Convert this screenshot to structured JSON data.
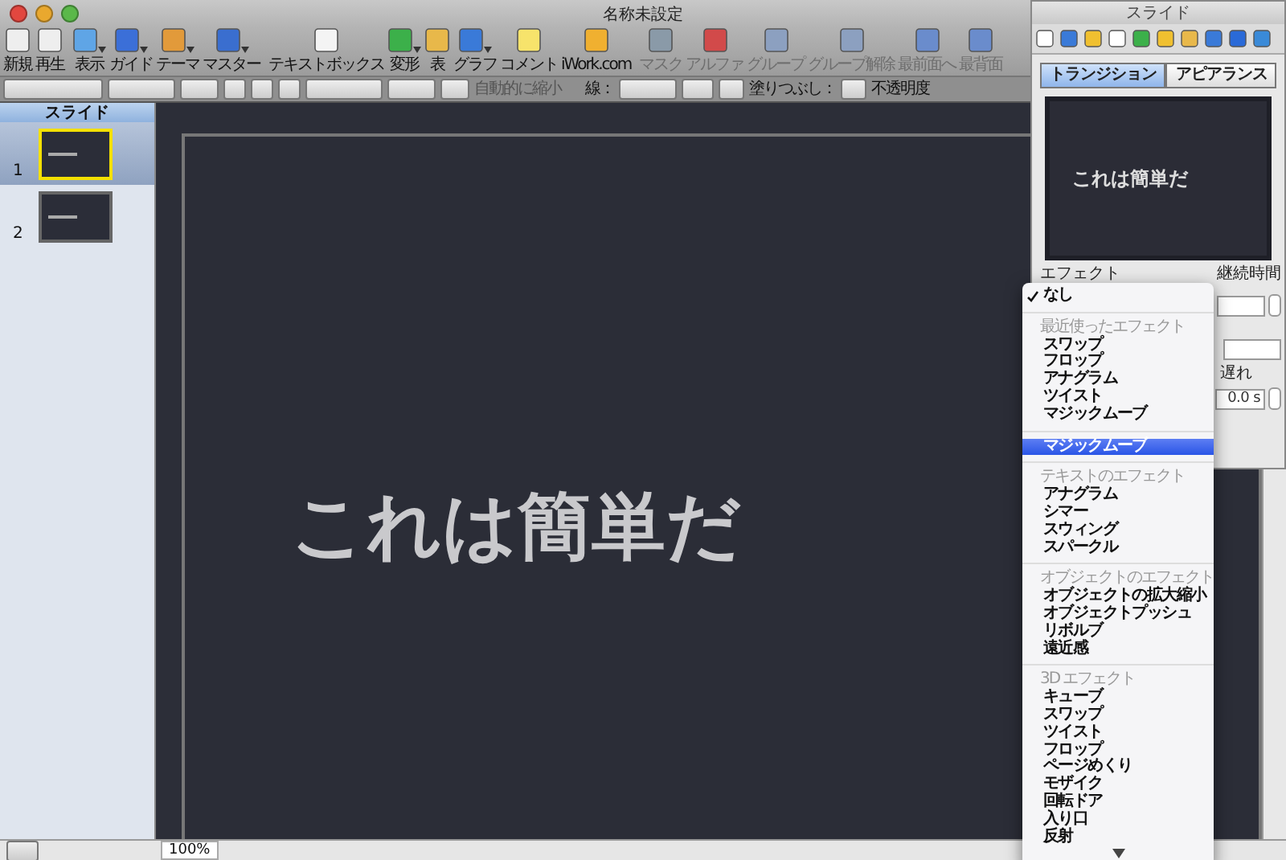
{
  "window": {
    "title": "名称未設定"
  },
  "toolbar": [
    {
      "label": "新規",
      "caret": false,
      "disabled": false
    },
    {
      "label": "再生",
      "caret": false,
      "disabled": false
    },
    {
      "label": "表示",
      "caret": true,
      "disabled": false
    },
    {
      "label": "ガイド",
      "caret": true,
      "disabled": false
    },
    {
      "label": "テーマ",
      "caret": true,
      "disabled": false
    },
    {
      "label": "マスター",
      "caret": true,
      "disabled": false
    },
    {
      "label": "テキストボックス",
      "caret": false,
      "disabled": false
    },
    {
      "label": "変形",
      "caret": true,
      "disabled": false
    },
    {
      "label": "表",
      "caret": false,
      "disabled": false
    },
    {
      "label": "グラフ",
      "caret": true,
      "disabled": false
    },
    {
      "label": "コメント",
      "caret": false,
      "disabled": false
    },
    {
      "label": "iWork.com",
      "caret": false,
      "disabled": false
    },
    {
      "label": "マスク",
      "caret": false,
      "disabled": true
    },
    {
      "label": "アルファ",
      "caret": false,
      "disabled": true
    },
    {
      "label": "グループ",
      "caret": false,
      "disabled": true
    },
    {
      "label": "グループ解除",
      "caret": false,
      "disabled": true
    },
    {
      "label": "最前面へ",
      "caret": false,
      "disabled": true
    },
    {
      "label": "最背面",
      "caret": false,
      "disabled": true
    }
  ],
  "format_bar": {
    "shrink_label": "自動的に縮小",
    "line_label": "線：",
    "fill_label": "塗りつぶし：",
    "opacity_label": "不透明度"
  },
  "sidebar": {
    "title": "スライド",
    "slides": [
      {
        "number": "1",
        "selected": true
      },
      {
        "number": "2",
        "selected": false
      }
    ]
  },
  "slide": {
    "text": "これは簡単だ"
  },
  "status_bar": {
    "zoom": "100%"
  },
  "inspector": {
    "title": "スライド",
    "tabs": [
      {
        "label": "トランジション",
        "selected": true
      },
      {
        "label": "アピアランス",
        "selected": false
      }
    ],
    "preview_text": "これは簡単だ",
    "effect_label": "エフェクト",
    "duration_label": "継続時間",
    "delay_label": "遅れ",
    "delay_value": "0.0 s"
  },
  "effect_menu": [
    {
      "kind": "item",
      "label": "なし",
      "checked": true,
      "selected": false
    },
    {
      "kind": "separator"
    },
    {
      "kind": "header",
      "label": "最近使ったエフェクト"
    },
    {
      "kind": "item",
      "label": "スワップ",
      "checked": false,
      "selected": false
    },
    {
      "kind": "item",
      "label": "フロップ",
      "checked": false,
      "selected": false
    },
    {
      "kind": "item",
      "label": "アナグラム",
      "checked": false,
      "selected": false
    },
    {
      "kind": "item",
      "label": "ツイスト",
      "checked": false,
      "selected": false
    },
    {
      "kind": "item",
      "label": "マジックムーブ",
      "checked": false,
      "selected": false
    },
    {
      "kind": "separator"
    },
    {
      "kind": "item",
      "label": "マジックムーブ",
      "checked": false,
      "selected": true
    },
    {
      "kind": "separator"
    },
    {
      "kind": "header",
      "label": "テキストのエフェクト"
    },
    {
      "kind": "item",
      "label": "アナグラム",
      "checked": false,
      "selected": false
    },
    {
      "kind": "item",
      "label": "シマー",
      "checked": false,
      "selected": false
    },
    {
      "kind": "item",
      "label": "スウィング",
      "checked": false,
      "selected": false
    },
    {
      "kind": "item",
      "label": "スパークル",
      "checked": false,
      "selected": false
    },
    {
      "kind": "separator"
    },
    {
      "kind": "header",
      "label": "オブジェクトのエフェクト"
    },
    {
      "kind": "item",
      "label": "オブジェクトの拡大縮小",
      "checked": false,
      "selected": false
    },
    {
      "kind": "item",
      "label": "オブジェクトプッシュ",
      "checked": false,
      "selected": false
    },
    {
      "kind": "item",
      "label": "リボルブ",
      "checked": false,
      "selected": false
    },
    {
      "kind": "item",
      "label": "遠近感",
      "checked": false,
      "selected": false
    },
    {
      "kind": "separator"
    },
    {
      "kind": "header",
      "label": "3D エフェクト"
    },
    {
      "kind": "item",
      "label": "キューブ",
      "checked": false,
      "selected": false
    },
    {
      "kind": "item",
      "label": "スワップ",
      "checked": false,
      "selected": false
    },
    {
      "kind": "item",
      "label": "ツイスト",
      "checked": false,
      "selected": false
    },
    {
      "kind": "item",
      "label": "フロップ",
      "checked": false,
      "selected": false
    },
    {
      "kind": "item",
      "label": "ページめくり",
      "checked": false,
      "selected": false
    },
    {
      "kind": "item",
      "label": "モザイク",
      "checked": false,
      "selected": false
    },
    {
      "kind": "item",
      "label": "回転ドア",
      "checked": false,
      "selected": false
    },
    {
      "kind": "item",
      "label": "入り口",
      "checked": false,
      "selected": false
    },
    {
      "kind": "item",
      "label": "反射",
      "checked": false,
      "selected": false
    }
  ]
}
